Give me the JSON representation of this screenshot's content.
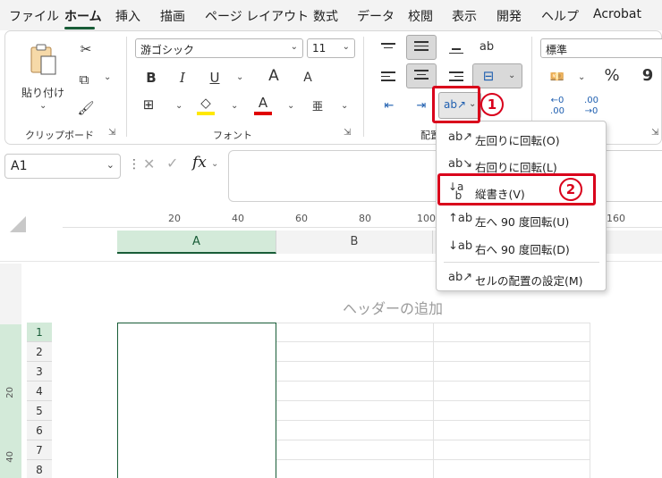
{
  "menubar": {
    "tabs": [
      "ファイル",
      "ホーム",
      "挿入",
      "描画",
      "ページ レイアウト",
      "数式",
      "データ",
      "校閲",
      "表示",
      "開発",
      "ヘルプ",
      "Acrobat"
    ],
    "active": "ホーム"
  },
  "clipboard": {
    "paste_label": "貼り付け",
    "group_label": "クリップボード"
  },
  "font": {
    "font_name": "游ゴシック",
    "font_size": "11",
    "bold": "B",
    "italic": "I",
    "underline": "U",
    "grow": "A",
    "shrink": "A",
    "font_color": "A",
    "phonetic": "亜",
    "group_label": "フォント"
  },
  "alignment": {
    "group_label": "配置"
  },
  "number": {
    "format": "標準",
    "percent": "%",
    "comma": "9"
  },
  "formula_bar": {
    "name_box": "A1",
    "fx": "fx"
  },
  "sheet": {
    "ruler": [
      "20",
      "40",
      "60",
      "80",
      "100",
      "160"
    ],
    "columns": [
      "A",
      "B"
    ],
    "header_text": "ヘッダーの追加",
    "rows": [
      "1",
      "2",
      "3",
      "4",
      "5",
      "6",
      "7",
      "8"
    ],
    "vruler": [
      "20",
      "40"
    ]
  },
  "orientation_menu": {
    "items": [
      {
        "label": "左回りに回転(O)",
        "icon": "rotate-ccw-icon"
      },
      {
        "label": "右回りに回転(L)",
        "icon": "rotate-cw-icon"
      },
      {
        "label": "縦書き(V)",
        "icon": "vertical-text-icon"
      },
      {
        "label": "左へ 90 度回転(U)",
        "icon": "rotate-up-icon"
      },
      {
        "label": "右へ 90 度回転(D)",
        "icon": "rotate-down-icon"
      },
      {
        "label": "セルの配置の設定(M)",
        "icon": "format-cells-alignment-icon"
      }
    ]
  },
  "annotations": {
    "step1": "1",
    "step2": "2"
  },
  "colors": {
    "accent": "#185c37",
    "highlight_red": "#d9001b",
    "font_color_bar": "#e00000",
    "fill_color_bar": "#ffe800"
  }
}
